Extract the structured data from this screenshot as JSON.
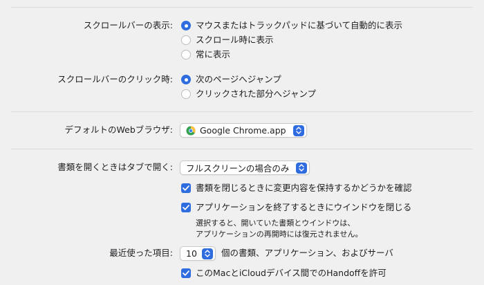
{
  "scroll_show": {
    "label": "スクロールバーの表示:",
    "options": [
      {
        "label": "マウスまたはトラックパッドに基づいて自動的に表示",
        "selected": true
      },
      {
        "label": "スクロール時に表示",
        "selected": false
      },
      {
        "label": "常に表示",
        "selected": false
      }
    ]
  },
  "scroll_click": {
    "label": "スクロールバーのクリック時:",
    "options": [
      {
        "label": "次のページへジャンプ",
        "selected": true
      },
      {
        "label": "クリックされた部分へジャンプ",
        "selected": false
      }
    ]
  },
  "default_browser": {
    "label": "デフォルトのWebブラウザ:",
    "value": "Google Chrome.app",
    "icon": "chrome-icon"
  },
  "tabs": {
    "label": "書類を開くときはタブで開く:",
    "value": "フルスクリーンの場合のみ"
  },
  "checkboxes": {
    "ask_keep_changes": {
      "label": "書類を閉じるときに変更内容を保持するかどうかを確認",
      "checked": true
    },
    "close_windows": {
      "label": "アプリケーションを終了するときにウインドウを閉じる",
      "checked": true,
      "note_line1": "選択すると、開いていた書類とウインドウは、",
      "note_line2": "アプリケーションの再開時には復元されません。"
    },
    "handoff": {
      "label": "このMacとiCloudデバイス間でのHandoffを許可",
      "checked": true
    }
  },
  "recent": {
    "label": "最近使った項目:",
    "value": "10",
    "suffix": "個の書類、アプリケーション、およびサーバ"
  },
  "colors": {
    "accent": "#2e6ce0",
    "background": "#f1f0f1",
    "divider": "#dcdbdc"
  }
}
